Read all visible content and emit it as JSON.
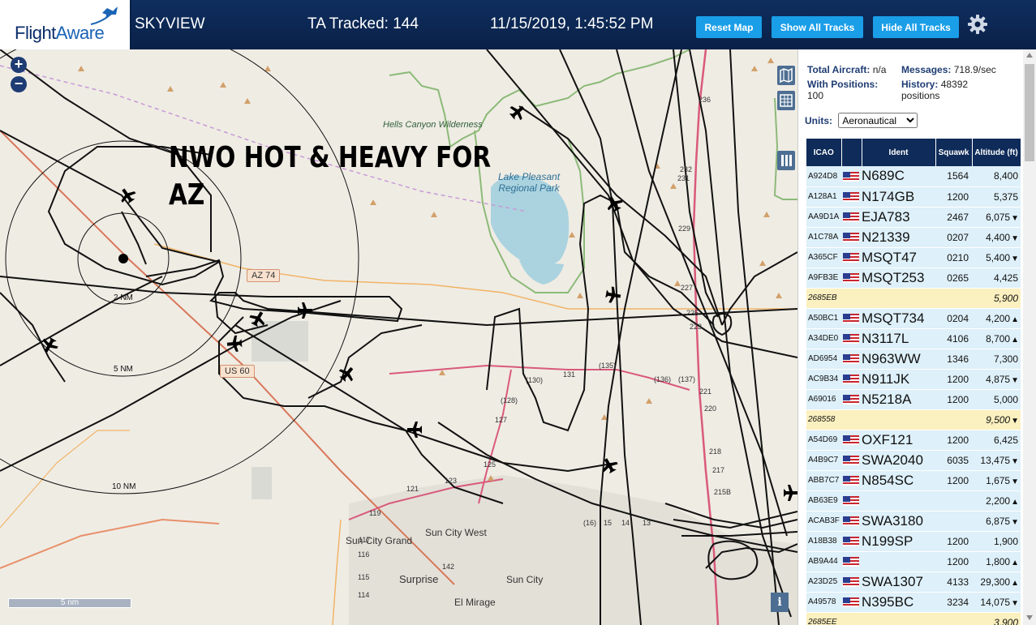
{
  "header": {
    "logo_primary": "Flight",
    "logo_secondary": "Aware",
    "app_title": "SKYVIEW",
    "ta_tracked": "TA Tracked: 144",
    "clock": "11/15/2019, 1:45:52 PM",
    "buttons": {
      "reset": "Reset Map",
      "show": "Show All Tracks",
      "hide": "Hide All Tracks"
    },
    "settings_icon": "gear-icon",
    "colors": {
      "header_bg": "#0a2148",
      "button": "#1a9ee8"
    }
  },
  "map": {
    "caption_line1": "NWO HOT & HEAVY FOR",
    "caption_line2": "AZ",
    "ring_labels": [
      "2 NM",
      "5 NM",
      "10 NM"
    ],
    "highway_shields": [
      "AZ 74",
      "US 60"
    ],
    "places": {
      "hells_canyon": "Hells Canyon Wilderness",
      "lake_pleasant": "Lake Pleasant Regional Park",
      "sun_city_grand": "Sun City Grand",
      "sun_city_west": "Sun City West",
      "surprise": "Surprise",
      "sun_city": "Sun City",
      "el_mirage": "El Mirage"
    },
    "road_numbers": [
      "236",
      "232",
      "231",
      "229",
      "227",
      "225",
      "223",
      "221",
      "220",
      "218",
      "217",
      "215B",
      "(130)",
      "131",
      "(135)",
      "(136)",
      "(137)",
      "(128)",
      "127",
      "125",
      "123",
      "121",
      "119",
      "117",
      "116",
      "115",
      "114",
      "142",
      "(16)",
      "15",
      "14",
      "13"
    ],
    "scale_label": "5 nm",
    "info_label": "i",
    "icons": [
      "zoom-in-icon",
      "zoom-out-icon",
      "layers-icon",
      "grid-icon",
      "columns-icon",
      "airplane-icon"
    ]
  },
  "sidebar": {
    "total_aircraft_label": "Total Aircraft:",
    "total_aircraft_value": "n/a",
    "messages_label": "Messages:",
    "messages_value": "718.9/sec",
    "positions_label": "With Positions:",
    "positions_value": "100",
    "history_label": "History:",
    "history_value": "48392",
    "history_unit": "positions",
    "units_label": "Units:",
    "units_value": "Aeronautical",
    "table": {
      "headers": [
        "ICAO",
        "",
        "Ident",
        "Squawk",
        "Altitude (ft)"
      ],
      "rows": [
        {
          "icao": "A924D8",
          "ident": "N689C",
          "squawk": "1564",
          "alt": "8,400",
          "trend": ""
        },
        {
          "icao": "A128A1",
          "ident": "N174GB",
          "squawk": "1200",
          "alt": "5,375",
          "trend": ""
        },
        {
          "icao": "AA9D1A",
          "ident": "EJA783",
          "squawk": "2467",
          "alt": "6,075",
          "trend": "▼"
        },
        {
          "icao": "A1C78A",
          "ident": "N21339",
          "squawk": "0207",
          "alt": "4,400",
          "trend": "▼"
        },
        {
          "icao": "A365CF",
          "ident": "MSQT47",
          "squawk": "0210",
          "alt": "5,400",
          "trend": "▼"
        },
        {
          "icao": "A9FB3E",
          "ident": "MSQT253",
          "squawk": "0265",
          "alt": "4,425",
          "trend": ""
        },
        {
          "icao": "2685EB",
          "ident": "",
          "squawk": "",
          "alt": "5,900",
          "trend": "",
          "nolist": true
        },
        {
          "icao": "A50BC1",
          "ident": "MSQT734",
          "squawk": "0204",
          "alt": "4,200",
          "trend": "▲"
        },
        {
          "icao": "A34DE0",
          "ident": "N3117L",
          "squawk": "4106",
          "alt": "8,700",
          "trend": "▲"
        },
        {
          "icao": "AD6954",
          "ident": "N963WW",
          "squawk": "1346",
          "alt": "7,300",
          "trend": ""
        },
        {
          "icao": "AC9B34",
          "ident": "N911JK",
          "squawk": "1200",
          "alt": "4,875",
          "trend": "▼"
        },
        {
          "icao": "A69016",
          "ident": "N5218A",
          "squawk": "1200",
          "alt": "5,000",
          "trend": ""
        },
        {
          "icao": "268558",
          "ident": "",
          "squawk": "",
          "alt": "9,500",
          "trend": "▼",
          "nolist": true
        },
        {
          "icao": "A54D69",
          "ident": "OXF121",
          "squawk": "1200",
          "alt": "6,425",
          "trend": ""
        },
        {
          "icao": "A4B9C7",
          "ident": "SWA2040",
          "squawk": "6035",
          "alt": "13,475",
          "trend": "▼"
        },
        {
          "icao": "ABB7C7",
          "ident": "N854SC",
          "squawk": "1200",
          "alt": "1,675",
          "trend": "▼"
        },
        {
          "icao": "AB63E9",
          "ident": "",
          "squawk": "",
          "alt": "2,200",
          "trend": "▲"
        },
        {
          "icao": "ACAB3F",
          "ident": "SWA3180",
          "squawk": "",
          "alt": "6,875",
          "trend": "▼"
        },
        {
          "icao": "A18B38",
          "ident": "N199SP",
          "squawk": "1200",
          "alt": "1,900",
          "trend": ""
        },
        {
          "icao": "AB9A44",
          "ident": "",
          "squawk": "1200",
          "alt": "1,800",
          "trend": "▲"
        },
        {
          "icao": "A23D25",
          "ident": "SWA1307",
          "squawk": "4133",
          "alt": "29,300",
          "trend": "▲"
        },
        {
          "icao": "A49578",
          "ident": "N395BC",
          "squawk": "3234",
          "alt": "14,075",
          "trend": "▼"
        },
        {
          "icao": "2685EE",
          "ident": "",
          "squawk": "",
          "alt": "3,900",
          "trend": "",
          "nolist": true
        }
      ]
    }
  }
}
